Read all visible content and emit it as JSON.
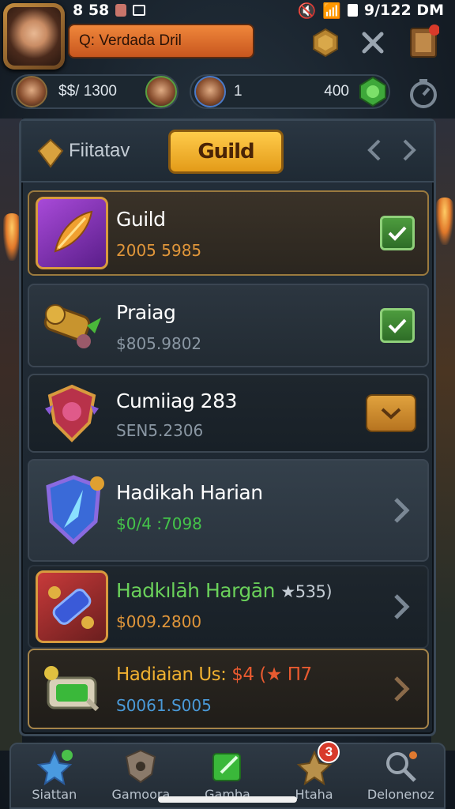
{
  "status_bar": {
    "left_text": "8 58",
    "time": "9/122 DM"
  },
  "header": {
    "quest_text": "Q: Verdada Dril"
  },
  "currency": {
    "gold": "$$/ 1300",
    "level": "1",
    "gems": "400"
  },
  "panel": {
    "filter_label": "Fiitatav",
    "active_tab": "Guild"
  },
  "rows": [
    {
      "title": "Guild",
      "sub": "2005 5985",
      "sub_color": "#e0963a",
      "action": "check"
    },
    {
      "title": "Praiag",
      "sub": "$805.9802",
      "sub_color": "#8a97a3",
      "action": "check"
    },
    {
      "title": "Cumiiag 283",
      "sub": "SEN5.2306",
      "sub_color": "#8a97a3",
      "action": "dropdown"
    },
    {
      "title": "Hadikah Harian",
      "sub": "$0/4 :7098",
      "sub_color": "#44c44a",
      "action": "chevron"
    },
    {
      "title": "Hadkılāh Hargān",
      "title_extra": "★535)",
      "sub": "$009.2800",
      "sub_color": "#e0963a",
      "action": "chevron"
    },
    {
      "title": "Hadiaian Us:",
      "title_extra": "$4 (★ Π7",
      "sub": "S0061.S005",
      "sub_color": "#4a9ad8",
      "action": "chevron"
    }
  ],
  "bottom_nav": [
    {
      "label": "Siattan",
      "icon": "star-icon"
    },
    {
      "label": "Gamoora",
      "icon": "shield-icon"
    },
    {
      "label": "Gamba",
      "icon": "pen-icon"
    },
    {
      "label": "Htaha",
      "icon": "star-icon",
      "badge": "3"
    },
    {
      "label": "Delonenoz",
      "icon": "search-icon"
    }
  ]
}
